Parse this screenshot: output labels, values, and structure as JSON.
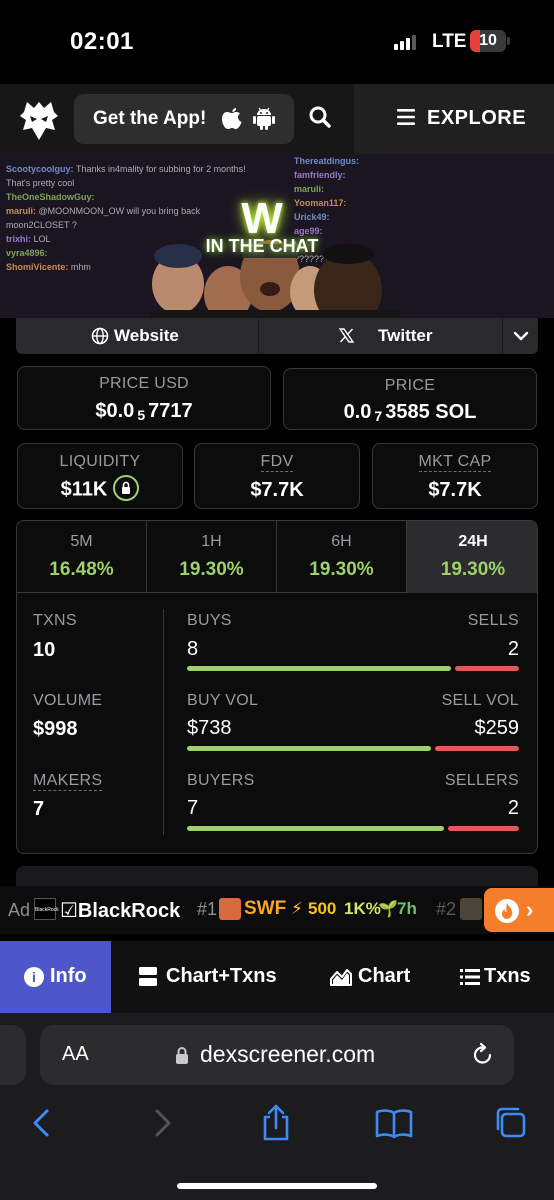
{
  "status_bar": {
    "time": "02:01",
    "network": "LTE",
    "battery": "10"
  },
  "nav": {
    "get_app": "Get the App!",
    "explore": "EXPLORE"
  },
  "banner": {
    "title": "W",
    "subtitle": "IN THE CHAT",
    "chat_left": [
      {
        "user": "Scootycoolguy:",
        "msg": "Thanks in4mality for subbing for 2 months!"
      },
      {
        "user": "",
        "msg": "That's pretty cool"
      },
      {
        "user": "TheOneShadowGuy:",
        "msg": ""
      },
      {
        "user": "maruli:",
        "msg": "@MOONMOON_OW will you bring back"
      },
      {
        "user": "",
        "msg": "moon2CLOSET ?"
      },
      {
        "user": "trixhi:",
        "msg": "LOL"
      },
      {
        "user": "vyra4896:",
        "msg": ""
      },
      {
        "user": "ShomiVicente:",
        "msg": "mhm"
      }
    ],
    "chat_right": [
      {
        "user": "Thereatdingus:",
        "msg": ""
      },
      {
        "user": "famfriendly:",
        "msg": ""
      },
      {
        "user": "maruli:",
        "msg": ""
      },
      {
        "user": "Yooman117:",
        "msg": ""
      },
      {
        "user": "Urick49:",
        "msg": ""
      },
      {
        "user": "age99:",
        "msg": ""
      },
      {
        "user": "",
        "msg": "LU"
      },
      {
        "user": "",
        "msg": "????????"
      }
    ]
  },
  "links": {
    "website": "Website",
    "twitter": "Twitter"
  },
  "price_usd": {
    "label": "PRICE USD",
    "prefix": "$0.0",
    "zeros": "5",
    "digits": "7717"
  },
  "price_sol": {
    "label": "PRICE",
    "prefix": "0.0",
    "zeros": "7",
    "digits": "3585 SOL"
  },
  "liquidity": {
    "label": "LIQUIDITY",
    "value": "$11K"
  },
  "fdv": {
    "label": "FDV",
    "value": "$7.7K"
  },
  "mkt_cap": {
    "label": "MKT CAP",
    "value": "$7.7K"
  },
  "timeframes": [
    {
      "label": "5M",
      "value": "16.48%"
    },
    {
      "label": "1H",
      "value": "19.30%"
    },
    {
      "label": "6H",
      "value": "19.30%"
    },
    {
      "label": "24H",
      "value": "19.30%"
    }
  ],
  "stats": {
    "txns": {
      "label": "TXNS",
      "value": "10"
    },
    "volume": {
      "label": "VOLUME",
      "value": "$998"
    },
    "makers": {
      "label": "MAKERS",
      "value": "7"
    },
    "buys": {
      "label": "BUYS",
      "value": "8",
      "fraction": 0.8
    },
    "sells": {
      "label": "SELLS",
      "value": "2"
    },
    "buy_vol": {
      "label": "BUY VOL",
      "value": "$738",
      "fraction": 0.74
    },
    "sell_vol": {
      "label": "SELL VOL",
      "value": "$259"
    },
    "buyers": {
      "label": "BUYERS",
      "value": "7",
      "fraction": 0.78
    },
    "sellers": {
      "label": "SELLERS",
      "value": "2"
    }
  },
  "ad": {
    "label": "Ad",
    "brand": "☑BlackRock",
    "brand_logo": "BlackRock",
    "rank1": "#1",
    "token1": "SWF",
    "boost": "500",
    "pct": "1K%",
    "age": "7h",
    "rank2": "#2"
  },
  "tabs": [
    {
      "label": "Info",
      "active": true
    },
    {
      "label": "Chart+Txns"
    },
    {
      "label": "Chart"
    },
    {
      "label": "Txns"
    }
  ],
  "safari": {
    "aa": "AA",
    "url": "dexscreener.com"
  },
  "colors": {
    "green": "#9ed16b",
    "red": "#e2595a",
    "accent": "#4d57c9",
    "orange": "#f57e2a"
  }
}
